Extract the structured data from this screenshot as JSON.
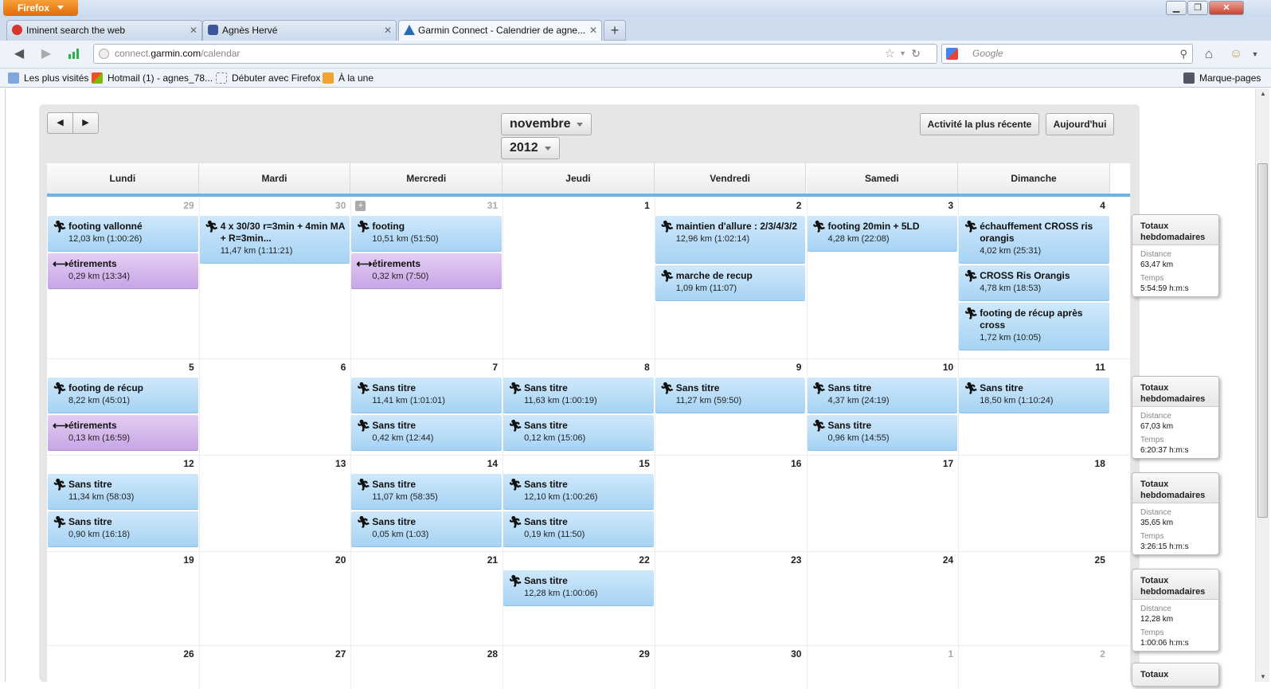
{
  "browser": {
    "app_button": "Firefox",
    "window_controls": [
      "▁",
      "❐",
      "✕"
    ],
    "tabs": [
      {
        "label": "Iminent search the web",
        "icon": "iminent-icon"
      },
      {
        "label": "Agnès Hervé",
        "icon": "facebook-icon"
      },
      {
        "label": "Garmin Connect - Calendrier de agne...",
        "icon": "garmin-icon",
        "active": true
      }
    ],
    "url_host": "connect.",
    "url_domain": "garmin.com",
    "url_path": "/calendar",
    "search_placeholder": "Google",
    "bookmarks": [
      "Les plus visités",
      "Hotmail (1) - agnes_78...",
      "Débuter avec Firefox",
      "À la une"
    ],
    "bookmarks_right": "Marque-pages"
  },
  "calendar": {
    "month": "novembre",
    "year": "2012",
    "btn_recent": "Activité la plus récente",
    "btn_today": "Aujourd'hui",
    "weekdays": [
      "Lundi",
      "Mardi",
      "Mercredi",
      "Jeudi",
      "Vendredi",
      "Samedi",
      "Dimanche"
    ],
    "weeks": [
      {
        "days": [
          "29",
          "30",
          "31",
          "1",
          "2",
          "3",
          "4"
        ],
        "dim": [
          true,
          true,
          true,
          false,
          false,
          false,
          false
        ],
        "events": [
          {
            "day": 0,
            "slot": 0,
            "title": "footing vallonné",
            "detail": "12,03 km (1:00:26)",
            "type": "run"
          },
          {
            "day": 0,
            "slot": 1,
            "title": "étirements",
            "detail": "0,29 km (13:34)",
            "type": "stretch"
          },
          {
            "day": 1,
            "slot": 0,
            "title": "4 x 30/30 r=3min + 4min MA + R=3min...",
            "detail": "11,47 km (1:11:21)",
            "type": "run",
            "lines": 2
          },
          {
            "day": 2,
            "slot": 0,
            "title": "footing",
            "detail": "10,51 km (51:50)",
            "type": "run"
          },
          {
            "day": 2,
            "slot": 1,
            "title": "étirements",
            "detail": "0,32 km (7:50)",
            "type": "stretch"
          },
          {
            "day": 4,
            "slot": 0,
            "title": "maintien d'allure : 2/3/4/3/2",
            "detail": "12,96 km (1:02:14)",
            "type": "run",
            "lines": 2
          },
          {
            "day": 4,
            "slot": 1,
            "title": "marche de recup",
            "detail": "1,09 km (11:07)",
            "type": "run",
            "after2": true
          },
          {
            "day": 5,
            "slot": 0,
            "title": "footing 20min + 5LD",
            "detail": "4,28 km (22:08)",
            "type": "run"
          },
          {
            "day": 6,
            "slot": 0,
            "title": "échauffement CROSS ris orangis",
            "detail": "4,02 km (25:31)",
            "type": "run",
            "lines": 2
          },
          {
            "day": 6,
            "slot": 1,
            "title": "CROSS Ris Orangis",
            "detail": "4,78 km (18:53)",
            "type": "run",
            "after2": true
          },
          {
            "day": 6,
            "slot": 2,
            "title": "footing de récup après cross",
            "detail": "1,72 km (10:05)",
            "type": "run",
            "lines": 2,
            "after2": true
          }
        ],
        "totals": {
          "title": "Totaux hebdomadaires",
          "dist_label": "Distance",
          "dist": "63,47 km",
          "time_label": "Temps",
          "time": "5:54:59 h:m:s"
        }
      },
      {
        "days": [
          "5",
          "6",
          "7",
          "8",
          "9",
          "10",
          "11"
        ],
        "dim": [
          false,
          false,
          false,
          false,
          false,
          false,
          false
        ],
        "events": [
          {
            "day": 0,
            "slot": 0,
            "title": "footing de récup",
            "detail": "8,22 km (45:01)",
            "type": "run"
          },
          {
            "day": 0,
            "slot": 1,
            "title": "étirements",
            "detail": "0,13 km (16:59)",
            "type": "stretch"
          },
          {
            "day": 2,
            "slot": 0,
            "title": "Sans titre",
            "detail": "11,41 km (1:01:01)",
            "type": "run"
          },
          {
            "day": 2,
            "slot": 1,
            "title": "Sans titre",
            "detail": "0,42 km (12:44)",
            "type": "run"
          },
          {
            "day": 3,
            "slot": 0,
            "title": "Sans titre",
            "detail": "11,63 km (1:00:19)",
            "type": "run"
          },
          {
            "day": 3,
            "slot": 1,
            "title": "Sans titre",
            "detail": "0,12 km (15:06)",
            "type": "run"
          },
          {
            "day": 4,
            "slot": 0,
            "title": "Sans titre",
            "detail": "11,27 km (59:50)",
            "type": "run"
          },
          {
            "day": 5,
            "slot": 0,
            "title": "Sans titre",
            "detail": "4,37 km (24:19)",
            "type": "run"
          },
          {
            "day": 5,
            "slot": 1,
            "title": "Sans titre",
            "detail": "0,96 km (14:55)",
            "type": "run"
          },
          {
            "day": 6,
            "slot": 0,
            "title": "Sans titre",
            "detail": "18,50 km (1:10:24)",
            "type": "run"
          }
        ],
        "totals": {
          "title": "Totaux hebdomadaires",
          "dist_label": "Distance",
          "dist": "67,03 km",
          "time_label": "Temps",
          "time": "6:20:37 h:m:s"
        }
      },
      {
        "days": [
          "12",
          "13",
          "14",
          "15",
          "16",
          "17",
          "18"
        ],
        "dim": [
          false,
          false,
          false,
          false,
          false,
          false,
          false
        ],
        "events": [
          {
            "day": 0,
            "slot": 0,
            "title": "Sans titre",
            "detail": "11,34 km (58:03)",
            "type": "run"
          },
          {
            "day": 0,
            "slot": 1,
            "title": "Sans titre",
            "detail": "0,90 km (16:18)",
            "type": "run"
          },
          {
            "day": 2,
            "slot": 0,
            "title": "Sans titre",
            "detail": "11,07 km (58:35)",
            "type": "run"
          },
          {
            "day": 2,
            "slot": 1,
            "title": "Sans titre",
            "detail": "0,05 km (1:03)",
            "type": "run"
          },
          {
            "day": 3,
            "slot": 0,
            "title": "Sans titre",
            "detail": "12,10 km (1:00:26)",
            "type": "run"
          },
          {
            "day": 3,
            "slot": 1,
            "title": "Sans titre",
            "detail": "0,19 km (11:50)",
            "type": "run"
          }
        ],
        "totals": {
          "title": "Totaux hebdomadaires",
          "dist_label": "Distance",
          "dist": "35,65 km",
          "time_label": "Temps",
          "time": "3:26:15 h:m:s"
        }
      },
      {
        "days": [
          "19",
          "20",
          "21",
          "22",
          "23",
          "24",
          "25"
        ],
        "dim": [
          false,
          false,
          false,
          false,
          false,
          false,
          false
        ],
        "events": [
          {
            "day": 3,
            "slot": 0,
            "title": "Sans titre",
            "detail": "12,28 km (1:00:06)",
            "type": "run"
          }
        ],
        "totals": {
          "title": "Totaux hebdomadaires",
          "dist_label": "Distance",
          "dist": "12,28 km",
          "time_label": "Temps",
          "time": "1:00:06 h:m:s"
        }
      },
      {
        "days": [
          "26",
          "27",
          "28",
          "29",
          "30",
          "1",
          "2"
        ],
        "dim": [
          false,
          false,
          false,
          false,
          false,
          true,
          true
        ],
        "events": [],
        "totals": {
          "title": "Totaux",
          "dist_label": "",
          "dist": "",
          "time_label": "",
          "time": ""
        }
      }
    ]
  }
}
